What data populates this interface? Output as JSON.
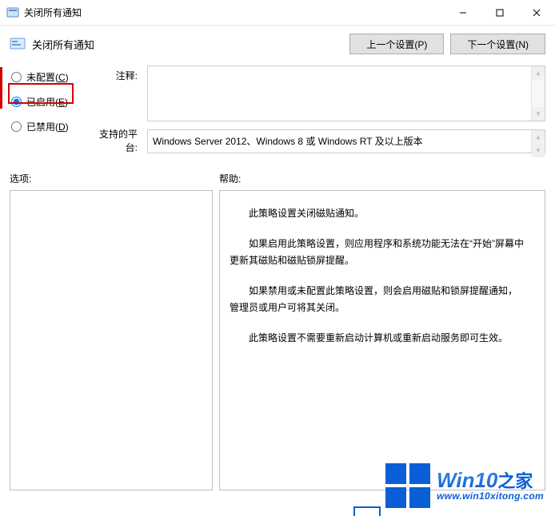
{
  "window": {
    "title": "关闭所有通知"
  },
  "header": {
    "policy_title": "关闭所有通知",
    "prev_button": "上一个设置(P)",
    "next_button": "下一个设置(N)"
  },
  "config": {
    "radio_not_configured": "未配置(C)",
    "radio_enabled": "已启用(E)",
    "radio_disabled": "已禁用(D)",
    "selected": "enabled",
    "comment_label": "注释:",
    "comment_value": "",
    "platform_label": "支持的平台:",
    "platform_value": "Windows Server 2012、Windows 8 或 Windows RT 及以上版本"
  },
  "sections": {
    "options_label": "选项:",
    "help_label": "帮助:"
  },
  "help": {
    "p1": "此策略设置关闭磁贴通知。",
    "p2": "如果启用此策略设置，则应用程序和系统功能无法在“开始”屏幕中更新其磁贴和磁贴锁屏提醒。",
    "p3": "如果禁用或未配置此策略设置，则会启用磁贴和锁屏提醒通知，管理员或用户可将其关闭。",
    "p4": "此策略设置不需要重新启动计算机或重新启动服务即可生效。"
  },
  "watermark": {
    "brand_main": "Win10",
    "brand_suffix": "之家",
    "url": "www.win10xitong.com"
  }
}
